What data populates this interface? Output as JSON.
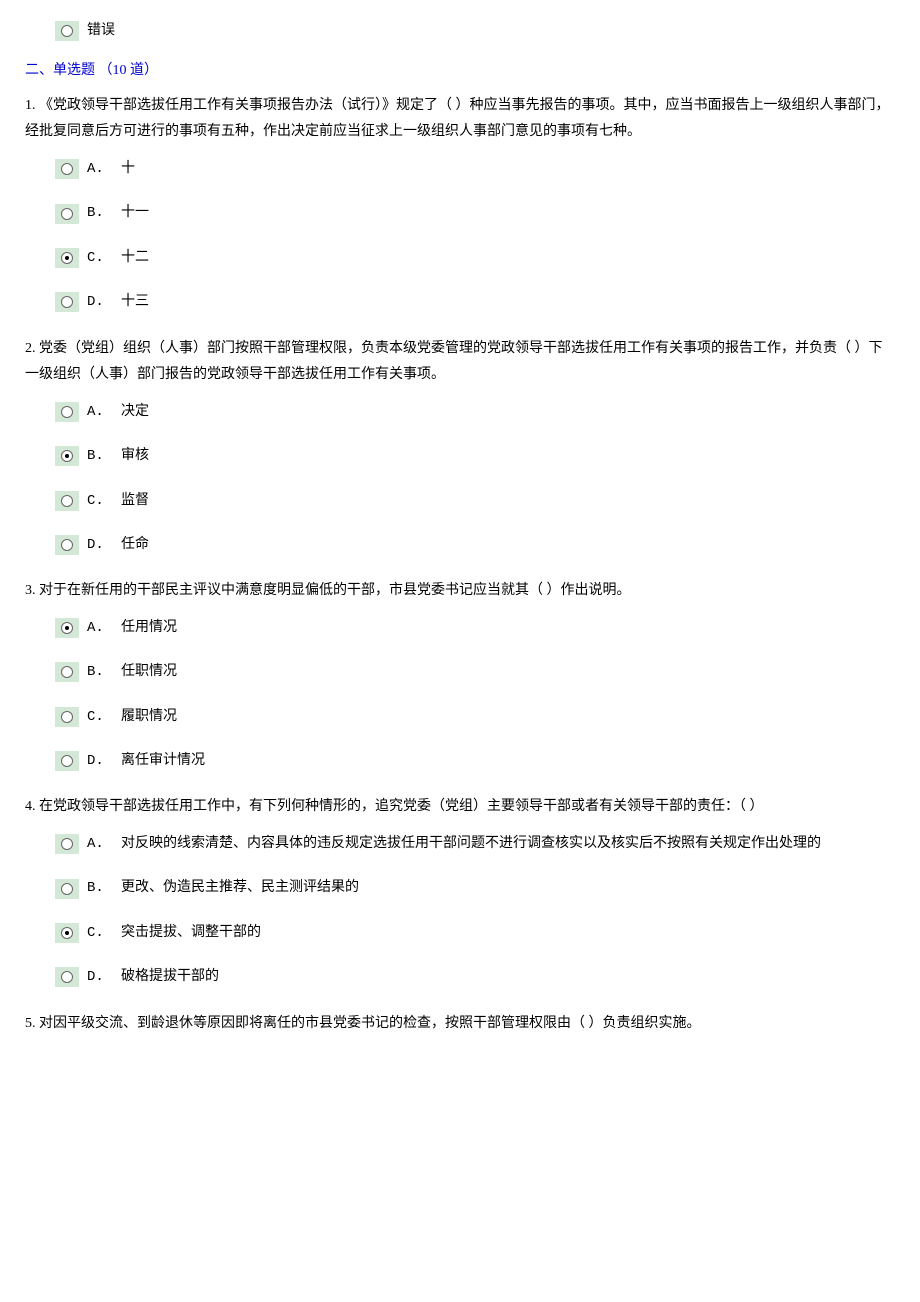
{
  "orphan_option": "错误",
  "section_header": "二、单选题 （10 道）",
  "questions": [
    {
      "num": "1.",
      "text": "《党政领导干部选拔任用工作有关事项报告办法（试行）》规定了（ ）种应当事先报告的事项。其中，应当书面报告上一级组织人事部门，经批复同意后方可进行的事项有五种，作出决定前应当征求上一级组织人事部门意见的事项有七种。",
      "options": [
        {
          "label": "A.",
          "text": "十",
          "selected": false
        },
        {
          "label": "B.",
          "text": "十一",
          "selected": false
        },
        {
          "label": "C.",
          "text": "十二",
          "selected": true
        },
        {
          "label": "D.",
          "text": "十三",
          "selected": false
        }
      ]
    },
    {
      "num": "2.",
      "text": "党委（党组）组织（人事）部门按照干部管理权限，负责本级党委管理的党政领导干部选拔任用工作有关事项的报告工作，并负责（ ）下一级组织（人事）部门报告的党政领导干部选拔任用工作有关事项。",
      "options": [
        {
          "label": "A.",
          "text": "决定",
          "selected": false
        },
        {
          "label": "B.",
          "text": "审核",
          "selected": true
        },
        {
          "label": "C.",
          "text": "监督",
          "selected": false
        },
        {
          "label": "D.",
          "text": "任命",
          "selected": false
        }
      ]
    },
    {
      "num": "3.",
      "text": "对于在新任用的干部民主评议中满意度明显偏低的干部，市县党委书记应当就其（ ）作出说明。",
      "options": [
        {
          "label": "A.",
          "text": "任用情况",
          "selected": true
        },
        {
          "label": "B.",
          "text": "任职情况",
          "selected": false
        },
        {
          "label": "C.",
          "text": "履职情况",
          "selected": false
        },
        {
          "label": "D.",
          "text": "离任审计情况",
          "selected": false
        }
      ]
    },
    {
      "num": "4.",
      "text": "在党政领导干部选拔任用工作中，有下列何种情形的，追究党委（党组）主要领导干部或者有关领导干部的责任：（ ）",
      "options": [
        {
          "label": "A.",
          "text": "对反映的线索清楚、内容具体的违反规定选拔任用干部问题不进行调查核实以及核实后不按照有关规定作出处理的",
          "selected": false
        },
        {
          "label": "B.",
          "text": "更改、伪造民主推荐、民主测评结果的",
          "selected": false
        },
        {
          "label": "C.",
          "text": "突击提拔、调整干部的",
          "selected": true
        },
        {
          "label": "D.",
          "text": "破格提拔干部的",
          "selected": false
        }
      ]
    },
    {
      "num": "5.",
      "text": "对因平级交流、到龄退休等原因即将离任的市县党委书记的检查，按照干部管理权限由（ ）负责组织实施。",
      "options": []
    }
  ]
}
